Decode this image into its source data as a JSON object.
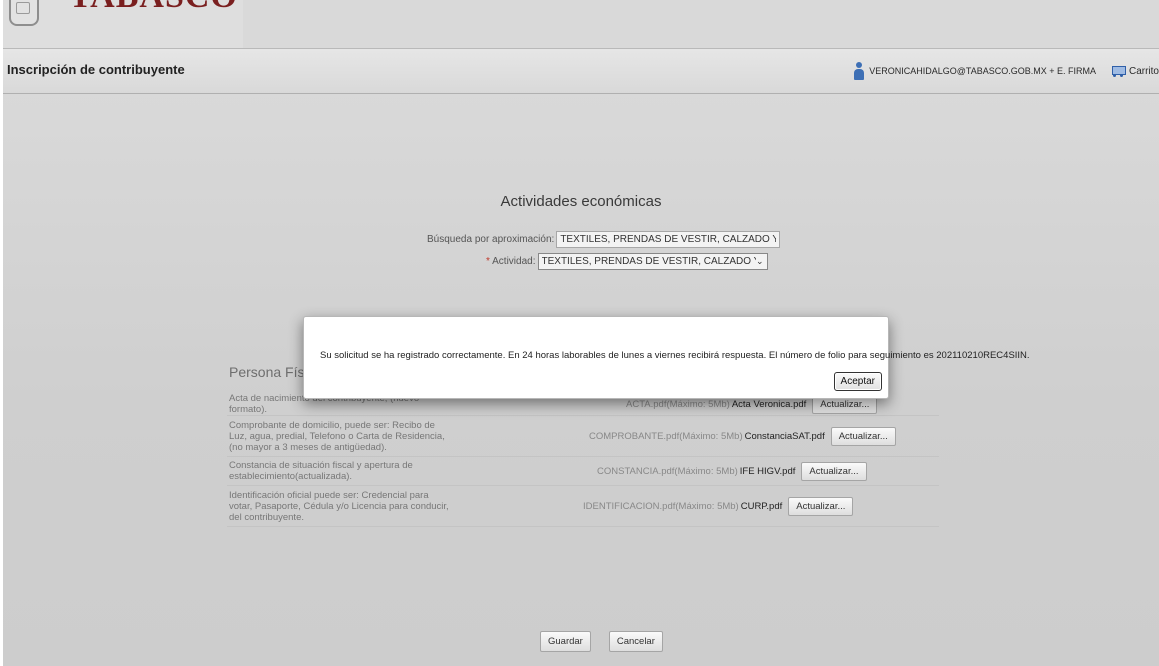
{
  "brand": {
    "logo_text": "TABASCO"
  },
  "header": {
    "title": "Inscripción de contribuyente",
    "user": "VERONICAHIDALGO@TABASCO.GOB.MX + E. FIRMA",
    "cart_label": "Carrito"
  },
  "actividades": {
    "title": "Actividades económicas",
    "search_label": "Búsqueda por aproximación:",
    "search_value": "TEXTILES, PRENDAS DE VESTIR, CALZADO Y OTROS ARTIC",
    "activity_required": "*",
    "activity_label": "Actividad:",
    "activity_value": "TEXTILES, PRENDAS DE VESTIR, CALZADO Y OTROS AR"
  },
  "persona": {
    "title": "Persona Física",
    "documents": [
      {
        "description": "Acta de nacimiento del contribuyente, (nuevo formato).",
        "hint": "ACTA.pdf(Máximo: 5Mb)",
        "file": "Acta Veronica.pdf",
        "button": "Actualizar..."
      },
      {
        "description": "Comprobante de domicilio, puede ser: Recibo de Luz, agua, predial, Telefono o Carta de Residencia, (no mayor a 3 meses de antigüedad).",
        "hint": "COMPROBANTE.pdf(Máximo: 5Mb)",
        "file": "ConstanciaSAT.pdf",
        "button": "Actualizar..."
      },
      {
        "description": "Constancia de situación fiscal y apertura de establecimiento(actualizada).",
        "hint": "CONSTANCIA.pdf(Máximo: 5Mb)",
        "file": "IFE HIGV.pdf",
        "button": "Actualizar..."
      },
      {
        "description": "Identificación oficial puede ser: Credencial para votar, Pasaporte, Cédula y/o Licencia para conducir, del contribuyente.",
        "hint": "IDENTIFICACION.pdf(Máximo: 5Mb)",
        "file": "CURP.pdf",
        "button": "Actualizar..."
      }
    ]
  },
  "footer": {
    "save_label": "Guardar",
    "cancel_label": "Cancelar"
  },
  "modal": {
    "message": "Su solicitud se ha registrado correctamente. En 24 horas laborables de lunes a viernes recibirá respuesta. El número de folio para seguimiento es 202110210REC4SIIN.",
    "ok_label": "Aceptar"
  }
}
